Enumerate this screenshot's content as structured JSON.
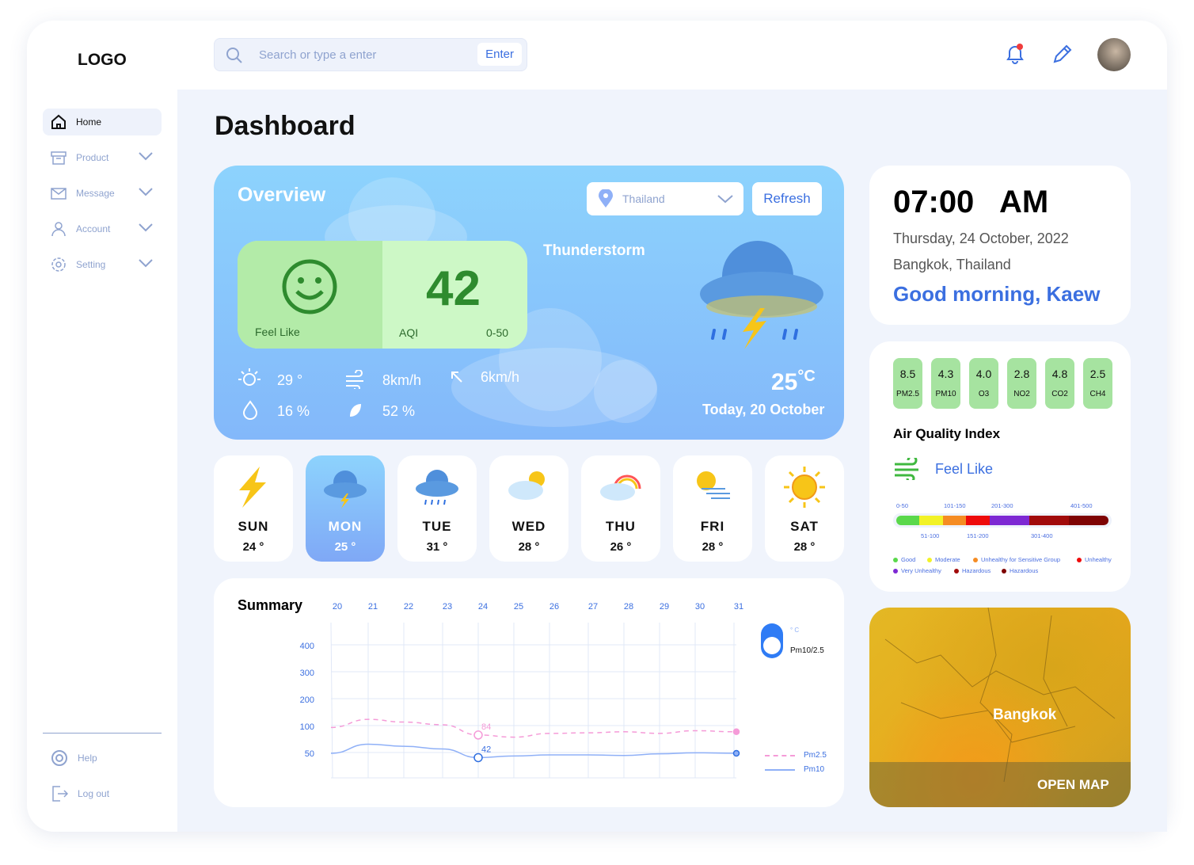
{
  "header": {
    "logo": "LOGO",
    "search_placeholder": "Search or type a enter",
    "enter_label": "Enter"
  },
  "sidebar": {
    "items": [
      {
        "label": "Home"
      },
      {
        "label": "Product"
      },
      {
        "label": "Message"
      },
      {
        "label": "Account"
      },
      {
        "label": "Setting"
      }
    ],
    "bottom": [
      {
        "label": "Help"
      },
      {
        "label": "Log out"
      }
    ]
  },
  "page_title": "Dashboard",
  "overview": {
    "title": "Overview",
    "location": "Thailand",
    "refresh": "Refresh",
    "aqi_value": "42",
    "feel_like": "Feel Like",
    "aqi_label": "AQI",
    "aqi_range": "0-50",
    "condition": "Thunderstorm",
    "temp": "29",
    "wind": "8",
    "wind_unit": "km/h",
    "gust": "6",
    "humidity": "16",
    "rain": "52",
    "current_temp": "25",
    "temp_unit": "°C",
    "date": "Today, 20 October"
  },
  "forecast": [
    {
      "day": "SUN",
      "temp": "24 °"
    },
    {
      "day": "MON",
      "temp": "25 °"
    },
    {
      "day": "TUE",
      "temp": "31 °"
    },
    {
      "day": "WED",
      "temp": "28 °"
    },
    {
      "day": "THU",
      "temp": "26 °"
    },
    {
      "day": "FRI",
      "temp": "28 °"
    },
    {
      "day": "SAT",
      "temp": "28 °"
    }
  ],
  "clock": {
    "time": "07:00",
    "ampm": "AM",
    "date": "Thursday, 24 October, 2022",
    "place": "Bangkok, Thailand",
    "greeting": "Good morning, Kaew"
  },
  "air": {
    "pollutants": [
      {
        "v": "8.5",
        "k": "PM2.5"
      },
      {
        "v": "4.3",
        "k": "PM10"
      },
      {
        "v": "4.0",
        "k": "O3"
      },
      {
        "v": "2.8",
        "k": "NO2"
      },
      {
        "v": "4.8",
        "k": "CO2"
      },
      {
        "v": "2.5",
        "k": "CH4"
      }
    ],
    "title": "Air Quality Index",
    "feel_like": "Feel Like",
    "top_ranges": [
      "0-50",
      "101-150",
      "201-300",
      "401-500"
    ],
    "bottom_ranges": [
      "51-100",
      "151-200",
      "301-400"
    ],
    "scale_colors": [
      "#5ad84b",
      "#f2f227",
      "#f58c23",
      "#ee0b0b",
      "#7d28d3",
      "#a10b0b",
      "#7e0404"
    ],
    "legend": [
      {
        "label": "Good",
        "color": "#5ad84b"
      },
      {
        "label": "Moderate",
        "color": "#f2f227"
      },
      {
        "label": "Unhealthy for Sensitive Group",
        "color": "#f58c23"
      },
      {
        "label": "Unhealthy",
        "color": "#ee0b0b"
      },
      {
        "label": "Very Unhealthy",
        "color": "#7d28d3"
      },
      {
        "label": "Hazardous",
        "color": "#a10b0b"
      },
      {
        "label": "Hazardous",
        "color": "#7e0404"
      }
    ]
  },
  "map": {
    "city": "Bangkok",
    "open": "OPEN MAP"
  },
  "chart_data": {
    "type": "line",
    "title": "Summary",
    "x": [
      20,
      21,
      22,
      23,
      24,
      25,
      26,
      27,
      28,
      29,
      30,
      31
    ],
    "y_ticks": [
      "400",
      "300",
      "200",
      "100",
      "50"
    ],
    "series": [
      {
        "name": "Pm2.5",
        "color": "#f59bd8",
        "values": [
          98,
          113,
          108,
          103,
          84,
          80,
          87,
          88,
          90,
          87,
          92,
          90
        ]
      },
      {
        "name": "Pm10",
        "color": "#8fb0f7",
        "values": [
          50,
          67,
          63,
          58,
          42,
          45,
          47,
          47,
          46,
          49,
          51,
          50
        ]
      }
    ],
    "highlight": {
      "day": 24,
      "labels": [
        "84",
        "42"
      ]
    },
    "toggle_unit": "° C",
    "toggle_label": "Pm10/2.5"
  }
}
